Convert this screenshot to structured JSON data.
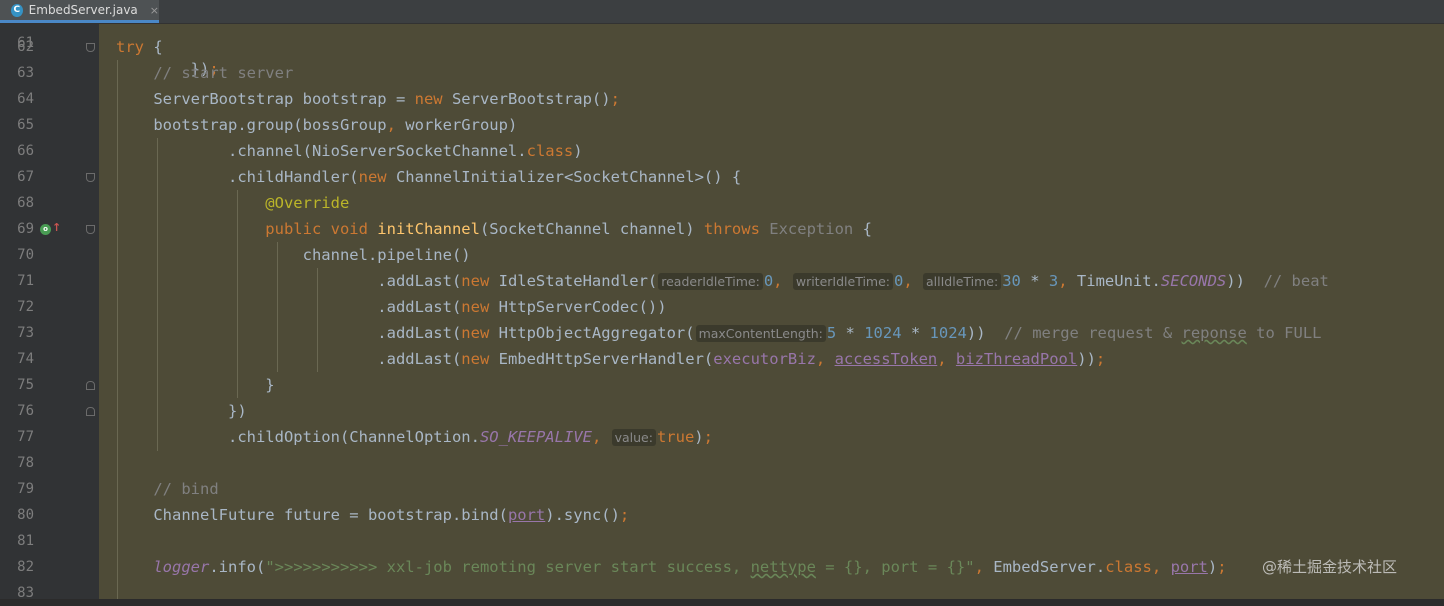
{
  "tab": {
    "icon_letter": "C",
    "filename": "EmbedServer.java",
    "close": "×"
  },
  "lines": [
    {
      "n": "62",
      "tokens": [
        [
          "k",
          "try"
        ],
        [
          "p",
          " {"
        ]
      ]
    },
    {
      "n": "63",
      "tokens": [
        [
          "c",
          "    // start server"
        ]
      ]
    },
    {
      "n": "64",
      "tokens": [
        [
          "p",
          "    ServerBootstrap bootstrap = "
        ],
        [
          "k",
          "new "
        ],
        [
          "p",
          "ServerBootstrap()"
        ],
        [
          "k",
          ";"
        ]
      ]
    },
    {
      "n": "65",
      "tokens": [
        [
          "p",
          "    bootstrap.group(bossGroup"
        ],
        [
          "k",
          ", "
        ],
        [
          "p",
          "workerGroup)"
        ]
      ]
    },
    {
      "n": "66",
      "tokens": [
        [
          "p",
          "            .channel(NioServerSocketChannel."
        ],
        [
          "k",
          "class"
        ],
        [
          "p",
          ")"
        ]
      ]
    },
    {
      "n": "67",
      "tokens": [
        [
          "p",
          "            .childHandler("
        ],
        [
          "k",
          "new "
        ],
        [
          "p",
          "ChannelInitializer<SocketChannel>() {"
        ]
      ]
    },
    {
      "n": "68",
      "tokens": [
        [
          "a",
          "                @Override"
        ]
      ]
    },
    {
      "n": "69",
      "tokens": [
        [
          "k",
          "                public void "
        ],
        [
          "fn",
          "initChannel"
        ],
        [
          "p",
          "(SocketChannel channel) "
        ],
        [
          "k",
          "throws "
        ],
        [
          "exc",
          "Exception"
        ],
        [
          "p",
          " {"
        ]
      ]
    },
    {
      "n": "70",
      "tokens": [
        [
          "p",
          "                    channel.pipeline()"
        ]
      ]
    },
    {
      "n": "71",
      "tokens": [
        [
          "p",
          "                            .addLast("
        ],
        [
          "k",
          "new "
        ],
        [
          "p",
          "IdleStateHandler("
        ],
        [
          "h",
          "readerIdleTime:"
        ],
        [
          "num",
          "0"
        ],
        [
          "k",
          ", "
        ],
        [
          "h",
          "writerIdleTime:"
        ],
        [
          "num",
          "0"
        ],
        [
          "k",
          ", "
        ],
        [
          "h",
          "allIdleTime:"
        ],
        [
          "num",
          "30 "
        ],
        [
          "p",
          "* "
        ],
        [
          "num",
          "3"
        ],
        [
          "k",
          ", "
        ],
        [
          "p",
          "TimeUnit."
        ],
        [
          "st",
          "SECONDS"
        ],
        [
          "p",
          "))  "
        ],
        [
          "c",
          "// beat"
        ]
      ]
    },
    {
      "n": "72",
      "tokens": [
        [
          "p",
          "                            .addLast("
        ],
        [
          "k",
          "new "
        ],
        [
          "p",
          "HttpServerCodec())"
        ]
      ]
    },
    {
      "n": "73",
      "tokens": [
        [
          "p",
          "                            .addLast("
        ],
        [
          "k",
          "new "
        ],
        [
          "p",
          "HttpObjectAggregator("
        ],
        [
          "h",
          "maxContentLength:"
        ],
        [
          "num",
          "5 "
        ],
        [
          "p",
          "* "
        ],
        [
          "num",
          "1024 "
        ],
        [
          "p",
          "* "
        ],
        [
          "num",
          "1024"
        ],
        [
          "p",
          "))  "
        ],
        [
          "c",
          "// merge request & "
        ],
        [
          "cw",
          "reponse"
        ],
        [
          "c",
          " to FULL"
        ]
      ]
    },
    {
      "n": "74",
      "tokens": [
        [
          "p",
          "                            .addLast("
        ],
        [
          "k",
          "new "
        ],
        [
          "p",
          "EmbedHttpServerHandler("
        ],
        [
          "fld",
          "executorBiz"
        ],
        [
          "k",
          ", "
        ],
        [
          "fldu",
          "accessToken"
        ],
        [
          "k",
          ", "
        ],
        [
          "fldu",
          "bizThreadPool"
        ],
        [
          "p",
          "))"
        ],
        [
          "k",
          ";"
        ]
      ]
    },
    {
      "n": "75",
      "tokens": [
        [
          "p",
          "                }"
        ]
      ]
    },
    {
      "n": "76",
      "tokens": [
        [
          "p",
          "            })"
        ]
      ]
    },
    {
      "n": "77",
      "tokens": [
        [
          "p",
          "            .childOption(ChannelOption."
        ],
        [
          "st",
          "SO_KEEPALIVE"
        ],
        [
          "k",
          ", "
        ],
        [
          "h",
          "value:"
        ],
        [
          "k",
          "true"
        ],
        [
          "p",
          ")"
        ],
        [
          "k",
          ";"
        ]
      ]
    },
    {
      "n": "78",
      "tokens": []
    },
    {
      "n": "79",
      "tokens": [
        [
          "c",
          "    // bind"
        ]
      ]
    },
    {
      "n": "80",
      "tokens": [
        [
          "p",
          "    ChannelFuture future = bootstrap.bind("
        ],
        [
          "fldu",
          "port"
        ],
        [
          "p",
          ").sync()"
        ],
        [
          "k",
          ";"
        ]
      ]
    },
    {
      "n": "81",
      "tokens": []
    },
    {
      "n": "82",
      "tokens": [
        [
          "st",
          "    logger"
        ],
        [
          "p",
          ".info("
        ],
        [
          "str",
          "\">>>>>>>>>>> xxl-job remoting server start success, "
        ],
        [
          "strw",
          "nettype"
        ],
        [
          "str",
          " = {}, port = {}\""
        ],
        [
          "k",
          ", "
        ],
        [
          "p",
          "EmbedServer."
        ],
        [
          "k",
          "class"
        ],
        [
          "k",
          ", "
        ],
        [
          "fldu",
          "port"
        ],
        [
          "p",
          ")"
        ],
        [
          "k",
          ";"
        ]
      ]
    },
    {
      "n": "83",
      "tokens": []
    }
  ],
  "first_partial_line": {
    "n": "61",
    "text": "        })",
    "tail": ";"
  },
  "watermark": "@稀土掘金技术社区",
  "colors": {
    "gutter": "#313335",
    "editor_bg": "#4e4b37",
    "keyword": "#cc7832",
    "comment": "#808080",
    "annotation": "#bbb529",
    "string": "#6a8759",
    "number": "#6897bb",
    "field": "#9876aa"
  }
}
